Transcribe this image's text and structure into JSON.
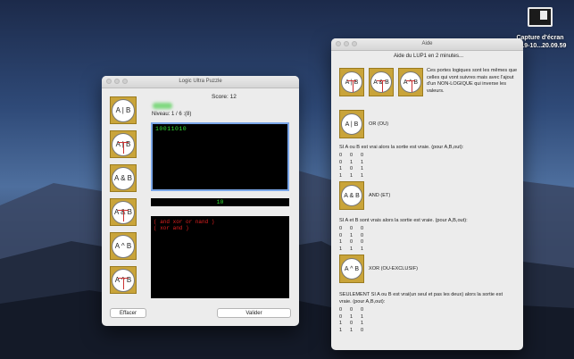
{
  "desktop": {
    "icon_label_1": "Capture d'écran",
    "icon_label_2": "2019-10...20.09.59"
  },
  "main_window": {
    "title": "Logic Ultra Puzzle",
    "score_label": "Score:  12",
    "level_label": "Niveau:  1 / 6  :(8)",
    "target_bits": "10011010",
    "current_output": "10",
    "errors": [
      "( and xor or nand )",
      "( xor and )"
    ],
    "gates": [
      "A | B",
      "A | B",
      "A & B",
      "A & B",
      "A ^ B",
      "A ^ B"
    ],
    "effacer_label": "Effacer",
    "valider_label": "Valider"
  },
  "help_window": {
    "title": "Aide",
    "heading": "Aide du LUP1 en 2 minutes...",
    "intro": "Ces portes logiques sont les mêmes que celles qui vont suivres mais avec l'ajout d'un NON-LOGIQUE qui inverse les valeurs.",
    "top_gates": [
      "A | B",
      "A & B",
      "A ^ B"
    ],
    "or_gate": "A | B",
    "or_label": "OR (OU)",
    "or_desc": "SI A ou B est vrai alors la sortie est vraie. (pour A,B,out):",
    "or_table": [
      [
        "0",
        "0",
        "0"
      ],
      [
        "0",
        "1",
        "1"
      ],
      [
        "1",
        "0",
        "1"
      ],
      [
        "1",
        "1",
        "1"
      ]
    ],
    "and_gate": "A & B",
    "and_label": "AND (ET)",
    "and_desc": "SI A et B sont vrais alors la sortie est vraie. (pour A,B,out):",
    "and_table": [
      [
        "0",
        "0",
        "0"
      ],
      [
        "0",
        "1",
        "0"
      ],
      [
        "1",
        "0",
        "0"
      ],
      [
        "1",
        "1",
        "1"
      ]
    ],
    "xor_gate": "A ^ B",
    "xor_label": "XOR (OU-EXCLUSIF)",
    "xor_desc": "SEULEMENT SI A ou B est vrai(un seul et pas les deux) alors la sortie est vraie. (pour A,B,out):",
    "xor_table": [
      [
        "0",
        "0",
        "0"
      ],
      [
        "0",
        "1",
        "1"
      ],
      [
        "1",
        "0",
        "1"
      ],
      [
        "1",
        "1",
        "0"
      ]
    ]
  }
}
